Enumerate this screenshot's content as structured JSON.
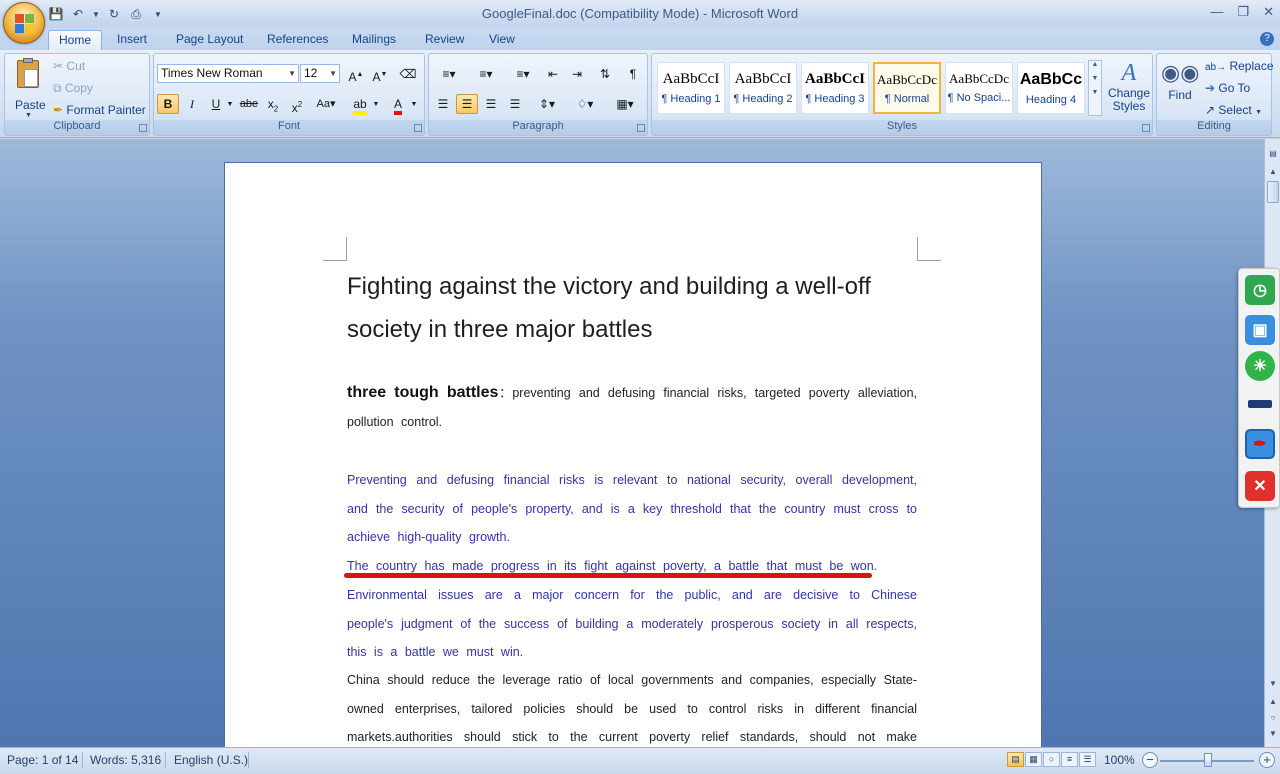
{
  "window": {
    "title": "GoogleFinal.doc (Compatibility Mode) - Microsoft Word",
    "controls": [
      "minimize-icon",
      "restore-icon",
      "close-icon"
    ]
  },
  "tabs": [
    "Home",
    "Insert",
    "Page Layout",
    "References",
    "Mailings",
    "Review",
    "View"
  ],
  "active_tab": "Home",
  "ribbon": {
    "clipboard": {
      "label": "Clipboard",
      "paste": "Paste",
      "cut": "Cut",
      "copy": "Copy",
      "format_painter": "Format Painter"
    },
    "font": {
      "label": "Font",
      "font_name": "Times New Roman",
      "font_size": "12"
    },
    "paragraph": {
      "label": "Paragraph"
    },
    "styles": {
      "label": "Styles",
      "items": [
        {
          "sample": "AaBbCcI",
          "name": "¶ Heading 1"
        },
        {
          "sample": "AaBbCcI",
          "name": "¶ Heading 2"
        },
        {
          "sample": "AaBbCcI",
          "name": "¶ Heading 3"
        },
        {
          "sample": "AaBbCcDc",
          "name": "¶ Normal"
        },
        {
          "sample": "AaBbCcDc",
          "name": "¶ No Spaci..."
        },
        {
          "sample": "AaBbCc",
          "name": "Heading 4"
        }
      ],
      "selected": "¶ Normal",
      "change_styles": "Change Styles"
    },
    "editing": {
      "label": "Editing",
      "find": "Find",
      "replace": "Replace",
      "goto": "Go To",
      "select": "Select"
    }
  },
  "document": {
    "title_line1": "Fighting against the victory and building a well-off",
    "title_line2": "society in three major battles",
    "lead_bold": "three tough battles",
    "lead_rest": "：preventing and defusing financial risks, targeted poverty alleviation, pollution control.",
    "blue_para1": "Preventing and defusing financial risks is relevant to national security, overall development, and the security of people's property, and is a key threshold that the country must cross to achieve high-quality growth.",
    "blue_para2": "The country has made progress in its fight against poverty, a battle that must be won.",
    "blue_para3": "Environmental issues are a major concern for the public, and are decisive to Chinese people's judgment of the success of building a moderately prosperous society in all respects, this is a battle we must win.",
    "black_para": "China should reduce the leverage ratio of local governments and companies, especially State-owned enterprises, tailored policies should be used to control risks in different financial markets.authorities should stick to the current poverty relief standards, should not make arbitrary decisions to r"
  },
  "status": {
    "page": "Page: 1 of 14",
    "words": "Words: 5,316",
    "language": "English (U.S.)",
    "zoom": "100%"
  },
  "colors": {
    "blue_text": "#3333aa",
    "underline_red": "#e01010",
    "ribbon_text": "#15428b"
  }
}
